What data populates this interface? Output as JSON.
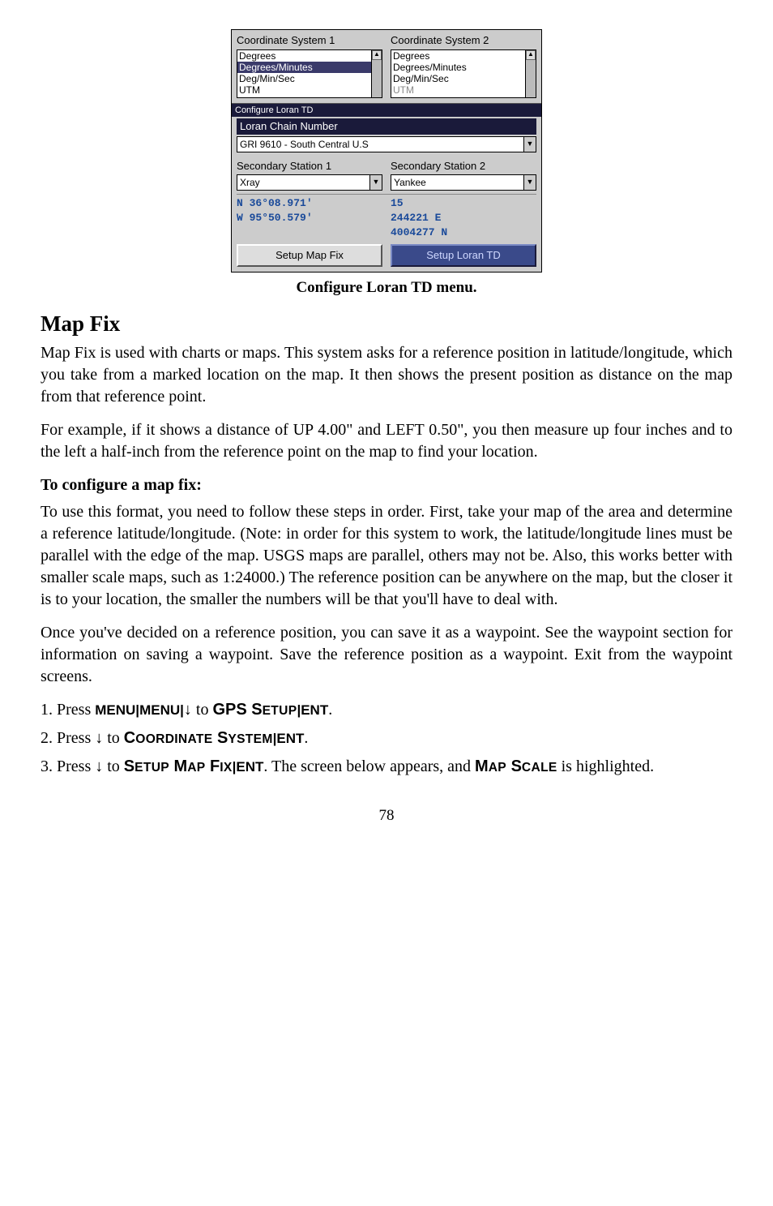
{
  "screenshot": {
    "top_panel": {
      "col1": {
        "label": "Coordinate System 1",
        "items": [
          "Degrees",
          "Degrees/Minutes",
          "Deg/Min/Sec",
          "UTM"
        ],
        "selected_index": 1
      },
      "col2": {
        "label": "Coordinate System 2",
        "items": [
          "Degrees",
          "Degrees/Minutes",
          "Deg/Min/Sec",
          "UTM"
        ],
        "dim_last": true
      }
    },
    "mid_panel": {
      "title_bar": "Configure Loran TD",
      "field_label": "Loran Chain Number",
      "chain_value": "GRI 9610 - South Central U.S",
      "sec1_label": "Secondary Station 1",
      "sec1_value": "Xray",
      "sec2_label": "Secondary Station 2",
      "sec2_value": "Yankee"
    },
    "bottom": {
      "left_lat": "N   36°08.971'",
      "left_lon": "W   95°50.579'",
      "right_zone": "15",
      "right_east": "244221 E",
      "right_north": "4004277 N",
      "btn1": "Setup Map Fix",
      "btn2": "Setup Loran TD"
    }
  },
  "caption": "Configure Loran TD menu.",
  "heading": "Map Fix",
  "para1": "Map Fix is used with charts or maps. This system asks for a reference position in latitude/longitude, which you take from a marked location on the map. It then shows the present position as distance on the map from that reference point.",
  "para2": "For example, if it shows a distance of UP 4.00\" and LEFT 0.50\", you then measure up four inches and to the left a half-inch from the reference point on the map to find your location.",
  "subhead": "To configure a map fix:",
  "para3": "To use this format, you need to follow these steps in order. First, take your map of the area and determine a reference latitude/longitude. (Note: in order for this system to work, the latitude/longitude lines must be parallel with the edge of the map. USGS maps are parallel, others may not be. Also, this works better with smaller scale maps, such as 1:24000.) The reference position can be anywhere on the map, but the closer it is to your location, the smaller the numbers will be that you'll have to deal with.",
  "para4": "Once you've decided on a reference position, you can save it as a waypoint. See the waypoint section for information on saving a waypoint. Save the reference position as a waypoint. Exit from the waypoint screens.",
  "steps": {
    "s1_pre": "1. Press ",
    "s2_pre": "2. Press ",
    "s3_pre": "3. Press ",
    "s3_mid": ". The screen below appears, and ",
    "s3_post": " is highlighted."
  },
  "ui": {
    "menu": "MENU",
    "gps_setup_pre": "GPS S",
    "gps_setup_sc": "ETUP",
    "ent": "ENT",
    "coord_pre": "C",
    "coord_sc1": "OORDINATE",
    "coord_mid": " S",
    "coord_sc2": "YSTEM",
    "setup_pre": "S",
    "setup_sc": "ETUP",
    "map_pre": " M",
    "map_sc": "AP",
    "fix_pre": " F",
    "fix_sc": "IX",
    "mapword_pre": "M",
    "mapword_sc": "AP",
    "scale_pre": "S",
    "scale_sc": "CALE"
  },
  "pagenum": "78"
}
